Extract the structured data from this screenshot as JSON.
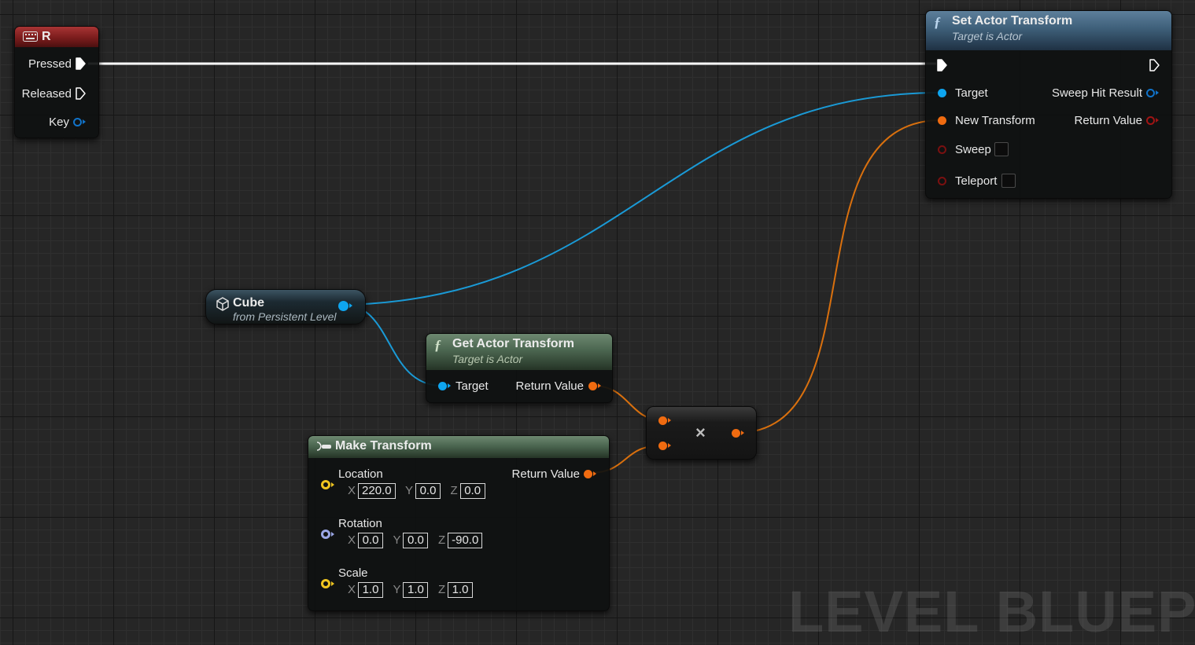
{
  "watermark": "LEVEL BLUEPRI",
  "colors": {
    "exec_wire": "#ffffff",
    "object_wire": "#1a9ad6",
    "transform_wire": "#d9700e",
    "set_header": "#3e5f79",
    "pure_header": "#4b6650",
    "event_header": "#7a1c1c"
  },
  "event_node": {
    "icon": "keyboard-icon",
    "title": "R",
    "pins": {
      "pressed": "Pressed",
      "released": "Released",
      "key": "Key"
    }
  },
  "set_actor_transform": {
    "icon": "function-icon",
    "title": "Set Actor Transform",
    "subtitle": "Target is Actor",
    "pins": {
      "target": "Target",
      "new_transform": "New Transform",
      "sweep": "Sweep",
      "teleport": "Teleport",
      "sweep_hit_result": "Sweep Hit Result",
      "return_value": "Return Value"
    }
  },
  "cube_node": {
    "icon": "cube-icon",
    "title": "Cube",
    "subtitle": "from Persistent Level"
  },
  "get_actor_transform": {
    "icon": "function-icon",
    "title": "Get Actor Transform",
    "subtitle": "Target is Actor",
    "pins": {
      "target": "Target",
      "return_value": "Return Value"
    }
  },
  "multiply_node": {
    "symbol": "×"
  },
  "make_transform": {
    "icon": "make-struct-icon",
    "title": "Make Transform",
    "return_value": "Return Value",
    "location": {
      "label": "Location",
      "x": "220.0",
      "y": "0.0",
      "z": "0.0"
    },
    "rotation": {
      "label": "Rotation",
      "x": "0.0",
      "y": "0.0",
      "z": "-90.0"
    },
    "scale": {
      "label": "Scale",
      "x": "1.0",
      "y": "1.0",
      "z": "1.0"
    },
    "axes": {
      "x": "X",
      "y": "Y",
      "z": "Z"
    }
  }
}
